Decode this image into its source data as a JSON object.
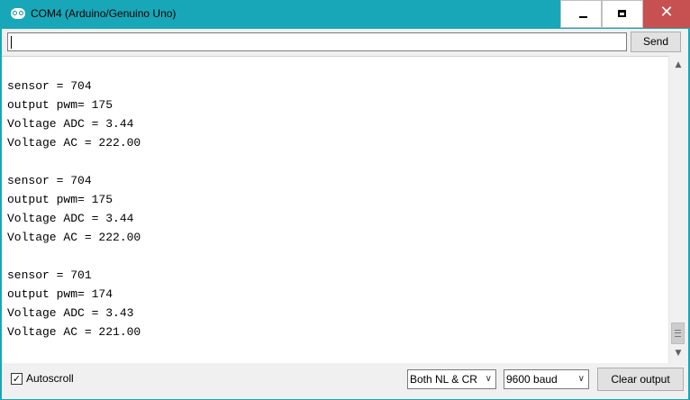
{
  "window": {
    "title": "COM4 (Arduino/Genuino Uno)",
    "controls": {
      "minimize": "‒",
      "maximize": "□",
      "close": "✕"
    }
  },
  "input": {
    "value": "",
    "send_label": "Send"
  },
  "output": {
    "lines": [
      "Voltage AC = 222.00",
      "",
      "sensor = 704",
      "output pwm= 175",
      "Voltage ADC = 3.44",
      "Voltage AC = 222.00",
      "",
      "sensor = 704",
      "output pwm= 175",
      "Voltage ADC = 3.44",
      "Voltage AC = 222.00",
      "",
      "sensor = 701",
      "output pwm= 174",
      "Voltage ADC = 3.43",
      "Voltage AC = 221.00"
    ]
  },
  "scrollbar": {
    "up_arrow": "▲",
    "down_arrow": "▼"
  },
  "footer": {
    "autoscroll_label": "Autoscroll",
    "autoscroll_checked": true,
    "line_ending": "Both NL & CR",
    "baud_rate": "9600 baud",
    "dropdown_arrow": "∨",
    "clear_label": "Clear output"
  },
  "icons": {
    "app": "arduino-logo-icon",
    "checkmark": "check-icon"
  },
  "colors": {
    "titlebar": "#17a7b8",
    "close_button": "#c75050",
    "client_bg": "#f0f0f0",
    "output_bg": "#ffffff"
  }
}
